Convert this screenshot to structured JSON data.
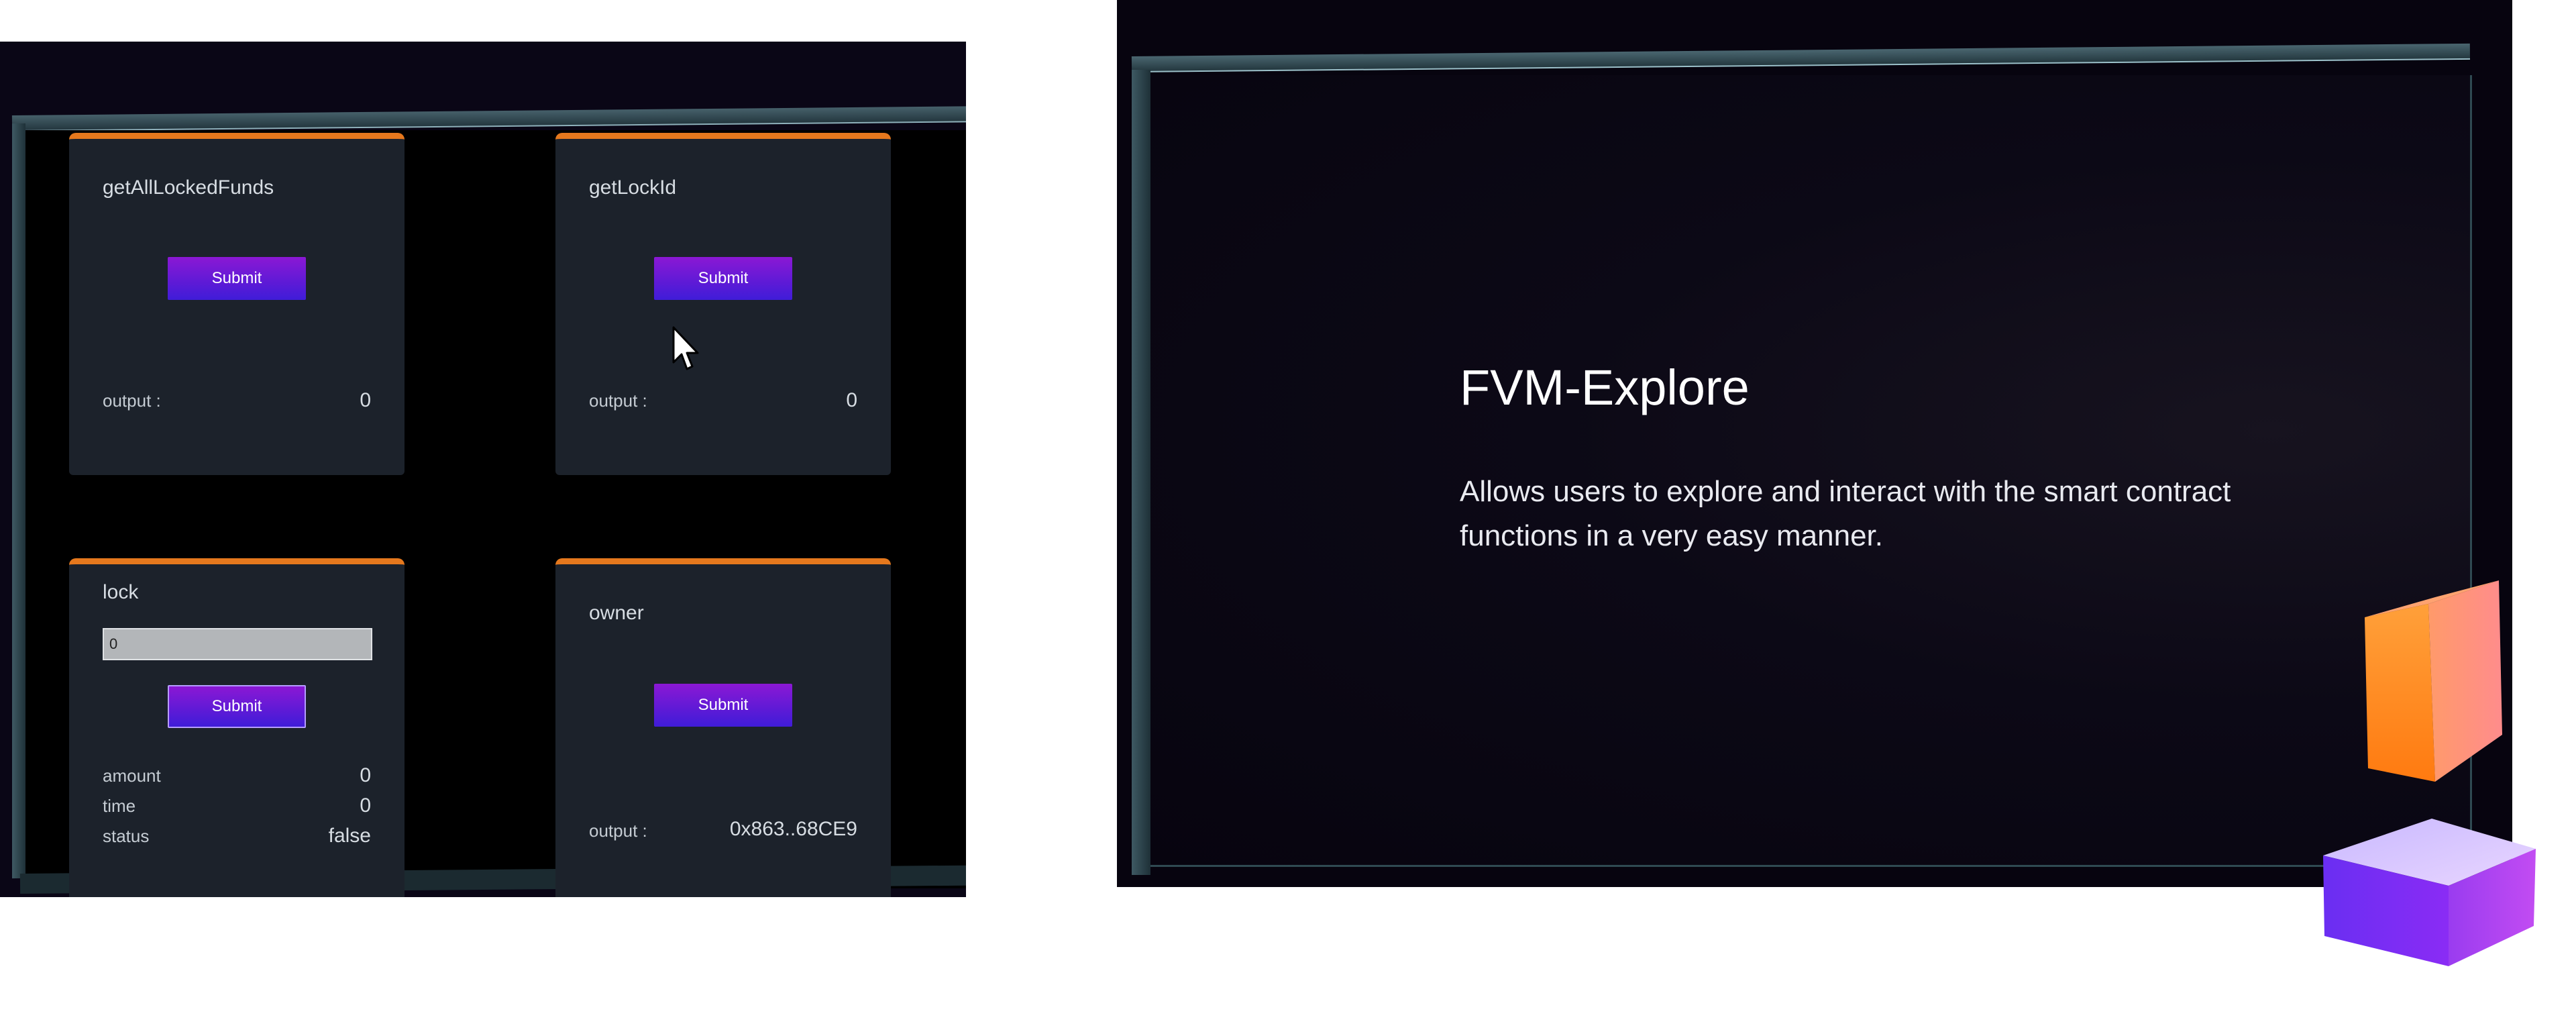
{
  "cards": [
    {
      "title": "getAllLockedFunds",
      "submit_label": "Submit",
      "rows": [
        {
          "label": "output :",
          "value": "0"
        }
      ]
    },
    {
      "title": "getLockId",
      "submit_label": "Submit",
      "rows": [
        {
          "label": "output :",
          "value": "0"
        }
      ]
    },
    {
      "title": "lock",
      "input_value": "0",
      "submit_label": "Submit",
      "rows": [
        {
          "label": "amount",
          "value": "0"
        },
        {
          "label": "time",
          "value": "0"
        },
        {
          "label": "status",
          "value": "false"
        }
      ]
    },
    {
      "title": "owner",
      "submit_label": "Submit",
      "rows": [
        {
          "label": "output :",
          "value": "0x863..68CE9"
        }
      ]
    }
  ],
  "hero": {
    "title": "FVM-Explore",
    "description": "Allows users to explore and interact with the smart contract functions in a very easy manner."
  },
  "colors": {
    "card_accent": "#e5781d",
    "button_gradient_start": "#8b18d4",
    "button_gradient_end": "#3f1cd8",
    "cube_orange": "#ff8a1e",
    "cube_purple": "#7a2cf0"
  },
  "icons": {
    "cursor": "mouse-pointer-icon",
    "decor_top": "orange-cube-icon",
    "decor_bottom": "purple-cube-icon"
  }
}
